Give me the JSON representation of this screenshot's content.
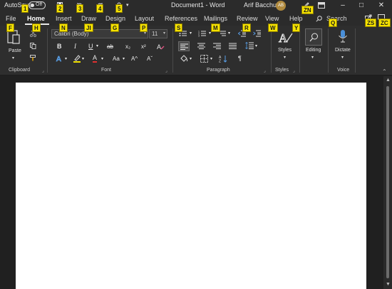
{
  "titlebar": {
    "autosave_label": "AutoSave",
    "autosave_state": "Off",
    "doc_title": "Document1  -  Word",
    "user_name": "Arif Bacchus",
    "avatar_initials": "AB"
  },
  "tabs": [
    {
      "label": "File"
    },
    {
      "label": "Home"
    },
    {
      "label": "Insert"
    },
    {
      "label": "Draw"
    },
    {
      "label": "Design"
    },
    {
      "label": "Layout"
    },
    {
      "label": "References"
    },
    {
      "label": "Mailings"
    },
    {
      "label": "Review"
    },
    {
      "label": "View"
    },
    {
      "label": "Help"
    }
  ],
  "search_label": "Search",
  "ribbon": {
    "clipboard": {
      "label": "Clipboard",
      "paste_label": "Paste"
    },
    "font": {
      "label": "Font",
      "font_name": "Calibri (Body)",
      "font_size": "11",
      "bold": "B",
      "italic": "I",
      "underline": "U",
      "strike": "ab",
      "subscript": "x₂",
      "superscript": "x²",
      "font_color_glyph": "A",
      "change_case": "Aa",
      "grow_font": "A^",
      "shrink_font": "Aˇ"
    },
    "paragraph": {
      "label": "Paragraph",
      "pilcrow": "¶"
    },
    "styles": {
      "label": "Styles",
      "button_label": "Styles"
    },
    "editing": {
      "button_label": "Editing"
    },
    "voice": {
      "label": "Voice",
      "button_label": "Dictate"
    }
  },
  "keytips": [
    "1",
    "2",
    "3",
    "4",
    "5",
    "ZN",
    "ZS",
    "ZC",
    "F",
    "H",
    "N",
    "JI",
    "G",
    "P",
    "S",
    "M",
    "R",
    "W",
    "Y",
    "Q"
  ],
  "colors": {
    "keytip_bg": "#f5e200",
    "font_color_accent": "#e03030",
    "highlight_accent": "#f0e000",
    "page": "#ffffff"
  }
}
